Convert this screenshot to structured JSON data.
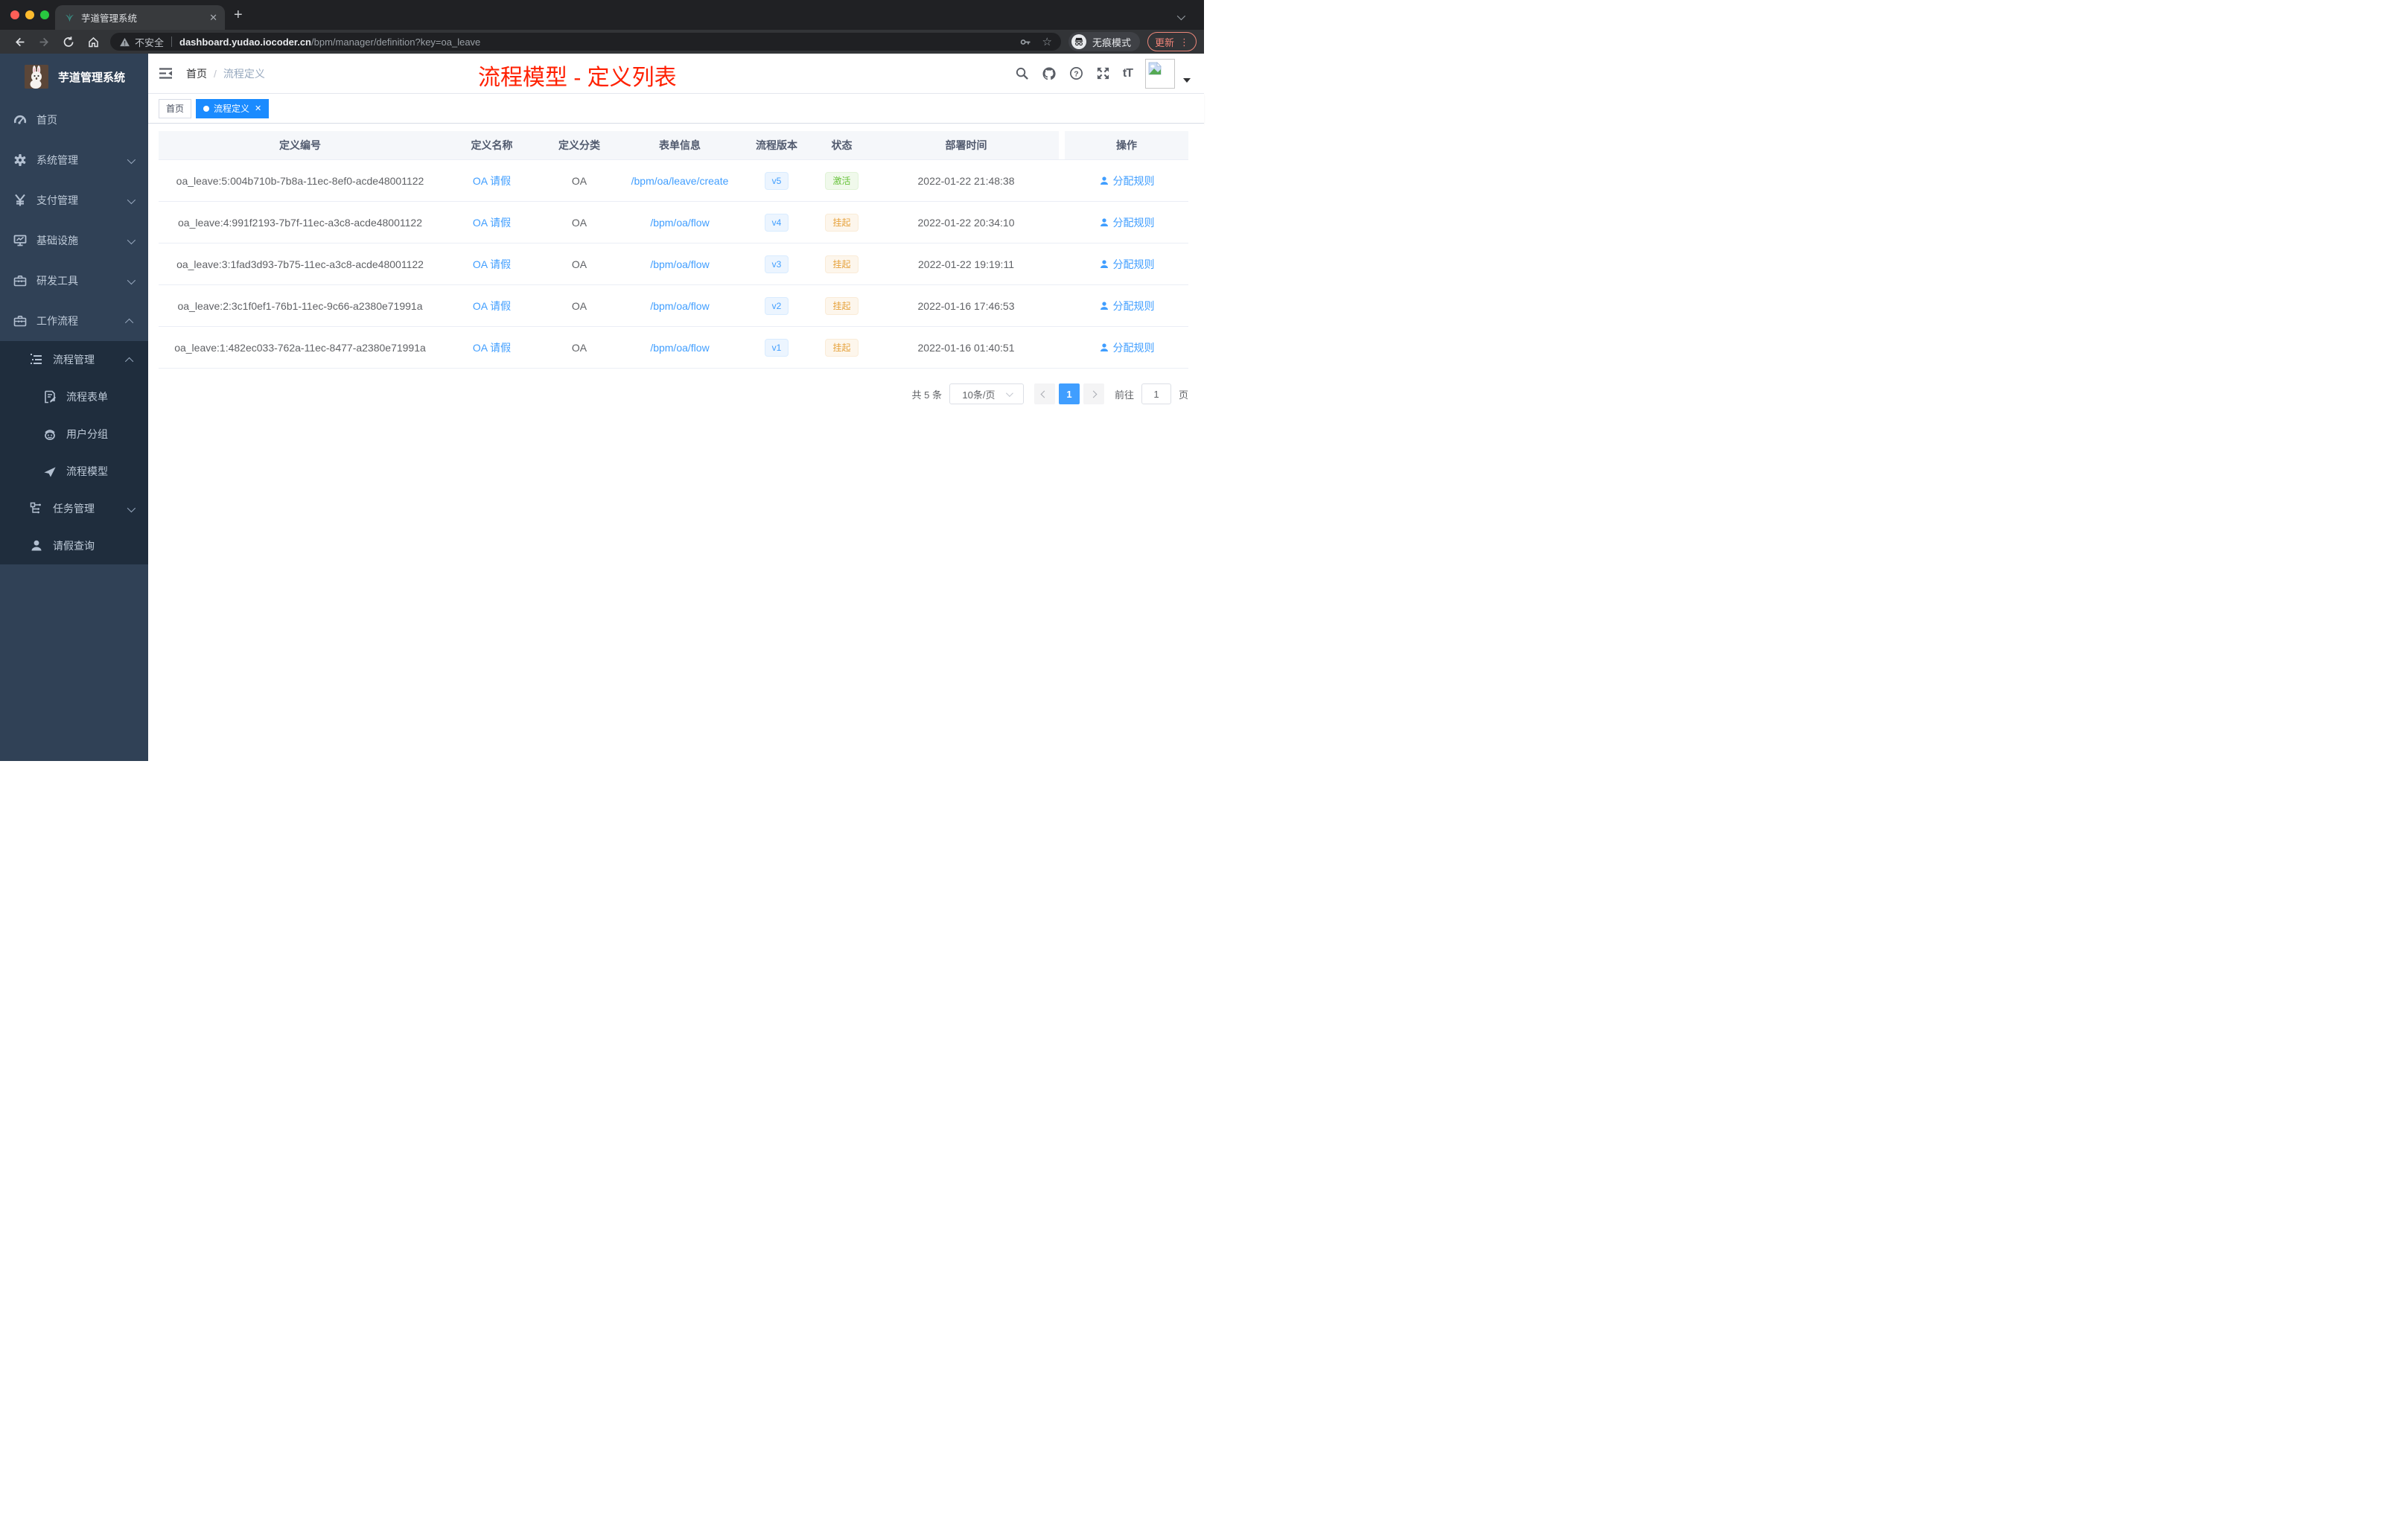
{
  "browser": {
    "tab_title": "芋道管理系统",
    "tab_close": "✕",
    "new_tab": "+",
    "security_label": "不安全",
    "url_host": "dashboard.yudao.iocoder.cn",
    "url_path": "/bpm/manager/definition?key=oa_leave",
    "incognito_label": "无痕模式",
    "update_label": "更新",
    "kebab": "⋮",
    "bookmark_star": "☆"
  },
  "header": {
    "breadcrumb_home": "首页",
    "breadcrumb_sep": "/",
    "breadcrumb_current": "流程定义",
    "annotation": "流程模型 - 定义列表",
    "annotation_color": "#ff2000",
    "font_size_icon": "tT"
  },
  "sidebar": {
    "logo_title": "芋道管理系统",
    "bg_color": "#304156",
    "submenu_bg_color": "#1f2d3d",
    "items": [
      {
        "key": "home",
        "label": "首页",
        "icon": "dashboard-icon",
        "level": 0,
        "chevron": null,
        "submenu": false
      },
      {
        "key": "system-management",
        "label": "系统管理",
        "icon": "gear-icon",
        "level": 0,
        "chevron": "down",
        "submenu": false
      },
      {
        "key": "payment-management",
        "label": "支付管理",
        "icon": "yen-icon",
        "level": 0,
        "chevron": "down",
        "submenu": false
      },
      {
        "key": "infrastructure",
        "label": "基础设施",
        "icon": "monitor-icon",
        "level": 0,
        "chevron": "down",
        "submenu": false
      },
      {
        "key": "dev-tools",
        "label": "研发工具",
        "icon": "toolbox-icon",
        "level": 0,
        "chevron": "down",
        "submenu": false
      },
      {
        "key": "workflow",
        "label": "工作流程",
        "icon": "toolbox-icon",
        "level": 0,
        "chevron": "up",
        "submenu": false
      },
      {
        "key": "process-management",
        "label": "流程管理",
        "icon": "list-tree-icon",
        "level": 1,
        "chevron": "up",
        "submenu": true
      },
      {
        "key": "process-form",
        "label": "流程表单",
        "icon": "form-edit-icon",
        "level": 2,
        "chevron": null,
        "submenu": true
      },
      {
        "key": "user-group",
        "label": "用户分组",
        "icon": "robot-icon",
        "level": 2,
        "chevron": null,
        "submenu": true
      },
      {
        "key": "process-model",
        "label": "流程模型",
        "icon": "paper-plane-icon",
        "level": 2,
        "chevron": null,
        "submenu": true
      },
      {
        "key": "task-management",
        "label": "任务管理",
        "icon": "tree-icon",
        "level": 1,
        "chevron": "down",
        "submenu": true
      },
      {
        "key": "leave-query",
        "label": "请假查询",
        "icon": "user-icon",
        "level": 1,
        "chevron": null,
        "submenu": true
      }
    ]
  },
  "tags": {
    "items": [
      {
        "label": "首页",
        "active": false
      },
      {
        "label": "流程定义",
        "active": true
      }
    ],
    "active_color": "#1a8bff"
  },
  "table": {
    "columns": [
      "定义编号",
      "定义名称",
      "定义分类",
      "表单信息",
      "流程版本",
      "状态",
      "部署时间",
      "操作"
    ],
    "status_colors": {
      "success": "#67c23a",
      "warning": "#e6a23c"
    },
    "accent_color": "#409eff",
    "rows": [
      {
        "id": "oa_leave:5:004b710b-7b8a-11ec-8ef0-acde48001122",
        "name": "OA 请假",
        "category": "OA",
        "form": "/bpm/oa/leave/create",
        "version": "v5",
        "status": "激活",
        "status_type": "success",
        "deployed_at": "2022-01-22 21:48:38",
        "action": "分配规则"
      },
      {
        "id": "oa_leave:4:991f2193-7b7f-11ec-a3c8-acde48001122",
        "name": "OA 请假",
        "category": "OA",
        "form": "/bpm/oa/flow",
        "version": "v4",
        "status": "挂起",
        "status_type": "warning",
        "deployed_at": "2022-01-22 20:34:10",
        "action": "分配规则"
      },
      {
        "id": "oa_leave:3:1fad3d93-7b75-11ec-a3c8-acde48001122",
        "name": "OA 请假",
        "category": "OA",
        "form": "/bpm/oa/flow",
        "version": "v3",
        "status": "挂起",
        "status_type": "warning",
        "deployed_at": "2022-01-22 19:19:11",
        "action": "分配规则"
      },
      {
        "id": "oa_leave:2:3c1f0ef1-76b1-11ec-9c66-a2380e71991a",
        "name": "OA 请假",
        "category": "OA",
        "form": "/bpm/oa/flow",
        "version": "v2",
        "status": "挂起",
        "status_type": "warning",
        "deployed_at": "2022-01-16 17:46:53",
        "action": "分配规则"
      },
      {
        "id": "oa_leave:1:482ec033-762a-11ec-8477-a2380e71991a",
        "name": "OA 请假",
        "category": "OA",
        "form": "/bpm/oa/flow",
        "version": "v1",
        "status": "挂起",
        "status_type": "warning",
        "deployed_at": "2022-01-16 01:40:51",
        "action": "分配规则"
      }
    ]
  },
  "pagination": {
    "total": "共 5 条",
    "page_size": "10条/页",
    "pages": [
      "1"
    ],
    "current": "1",
    "goto_label": "前往",
    "goto_value": "1",
    "goto_unit": "页"
  }
}
